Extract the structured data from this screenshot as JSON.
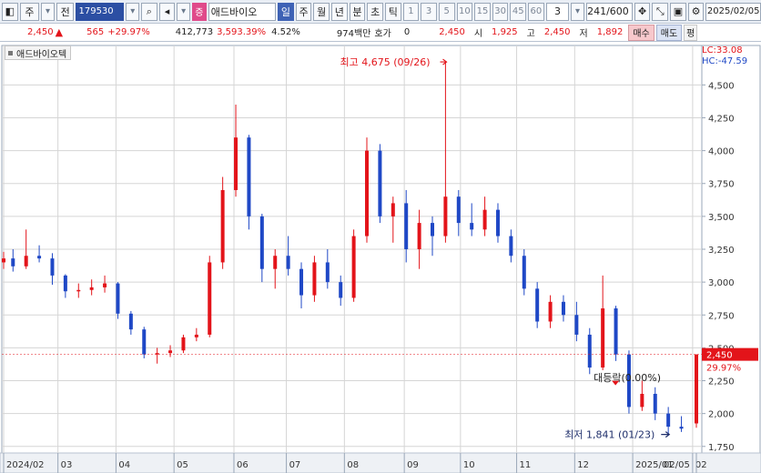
{
  "toolbar": {
    "market": "주",
    "type": "전",
    "code": "179530",
    "badge": "증",
    "name": "애드바이오",
    "periods": [
      "일",
      "주",
      "월",
      "년",
      "분",
      "초",
      "틱"
    ],
    "active_period": "일",
    "intervals": [
      "1",
      "3",
      "5",
      "10",
      "15",
      "30",
      "45",
      "60"
    ],
    "multiplier": "3",
    "count": "241/600",
    "date": "2025/02/05",
    "icons": [
      "chart-type-icon",
      "dropdown-icon",
      "search-icon",
      "speaker-icon",
      "dropdown-icon",
      "crosshair-icon",
      "tools-icon",
      "save-icon",
      "settings-icon"
    ]
  },
  "pricebar": {
    "price": "2,450",
    "arrow": "up",
    "change": "565",
    "change_pct": "+29.97%",
    "volume": "412,773",
    "volume_pct": "3,593.39%",
    "turnover": "4.52%",
    "amount": "974백만",
    "quote_label": "호가",
    "quote_value": "0",
    "quote_price": "2,450",
    "open_label": "시",
    "open": "1,925",
    "high_label": "고",
    "high": "2,450",
    "low_label": "저",
    "low": "1,892",
    "buy": "매수",
    "sell": "매도",
    "avg": "평"
  },
  "chart_header": {
    "stock_name": "애드바이오텍",
    "lc": "LC:33.08",
    "hc": "HC:-47.59"
  },
  "colors": {
    "up": "#e3141a",
    "down": "#1f48c6",
    "grid": "#d5d5d5",
    "background": "#ffffff"
  },
  "chart_data": {
    "type": "candlestick",
    "title": "",
    "xlabel": "",
    "ylabel": "",
    "ylim": [
      1700,
      4800
    ],
    "yticks": [
      1750,
      2000,
      2250,
      2500,
      2750,
      3000,
      3250,
      3500,
      3750,
      4000,
      4250,
      4500
    ],
    "ytick_labels": [
      "1,750",
      "2,000",
      "2,250",
      "2,500",
      "2,750",
      "3,000",
      "3,250",
      "3,500",
      "3,750",
      "4,000",
      "4,250",
      "4,500"
    ],
    "month_ticks": [
      {
        "label": "2024/02",
        "date": "2024-02-01"
      },
      {
        "label": "03",
        "date": "2024-03-01"
      },
      {
        "label": "04",
        "date": "2024-04-01"
      },
      {
        "label": "05",
        "date": "2024-05-02"
      },
      {
        "label": "06",
        "date": "2024-06-03"
      },
      {
        "label": "07",
        "date": "2024-07-01"
      },
      {
        "label": "08",
        "date": "2024-08-01"
      },
      {
        "label": "09",
        "date": "2024-09-02"
      },
      {
        "label": "10",
        "date": "2024-10-02"
      },
      {
        "label": "11",
        "date": "2024-11-01"
      },
      {
        "label": "12",
        "date": "2024-12-02"
      },
      {
        "label": "2025/01",
        "date": "2025-01-02"
      },
      {
        "label": "02",
        "date": "2025-02-03"
      },
      {
        "label": "02/05",
        "date": "2025-02-05"
      }
    ],
    "grid": true,
    "annotations": {
      "high": {
        "label": "최고 4,675 (09/26)",
        "value": 4675,
        "date": "2024-09-26"
      },
      "low": {
        "label": "최저 1,841 (01/23)",
        "value": 1841,
        "date": "2025-01-23"
      },
      "mid": {
        "label": "대등락(0.00%)"
      },
      "current_price": {
        "label": "2,450",
        "value": 2450
      },
      "current_change": {
        "label": "29.97%"
      }
    },
    "series": [
      {
        "date": "2024-02-01",
        "open": 3150,
        "high": 3230,
        "low": 3100,
        "close": 3180
      },
      {
        "date": "2024-02-06",
        "open": 3180,
        "high": 3250,
        "low": 3080,
        "close": 3120
      },
      {
        "date": "2024-02-13",
        "open": 3120,
        "high": 3400,
        "low": 3100,
        "close": 3200
      },
      {
        "date": "2024-02-20",
        "open": 3200,
        "high": 3280,
        "low": 3150,
        "close": 3180
      },
      {
        "date": "2024-02-27",
        "open": 3180,
        "high": 3220,
        "low": 2980,
        "close": 3050
      },
      {
        "date": "2024-03-05",
        "open": 3050,
        "high": 3060,
        "low": 2880,
        "close": 2930
      },
      {
        "date": "2024-03-12",
        "open": 2930,
        "high": 2990,
        "low": 2880,
        "close": 2940
      },
      {
        "date": "2024-03-19",
        "open": 2940,
        "high": 3020,
        "low": 2900,
        "close": 2960
      },
      {
        "date": "2024-03-26",
        "open": 2960,
        "high": 3050,
        "low": 2920,
        "close": 2990
      },
      {
        "date": "2024-04-02",
        "open": 2990,
        "high": 3000,
        "low": 2720,
        "close": 2760
      },
      {
        "date": "2024-04-09",
        "open": 2760,
        "high": 2780,
        "low": 2600,
        "close": 2640
      },
      {
        "date": "2024-04-16",
        "open": 2640,
        "high": 2660,
        "low": 2420,
        "close": 2450
      },
      {
        "date": "2024-04-23",
        "open": 2450,
        "high": 2500,
        "low": 2380,
        "close": 2460
      },
      {
        "date": "2024-04-30",
        "open": 2460,
        "high": 2520,
        "low": 2430,
        "close": 2480
      },
      {
        "date": "2024-05-07",
        "open": 2480,
        "high": 2600,
        "low": 2460,
        "close": 2580
      },
      {
        "date": "2024-05-14",
        "open": 2580,
        "high": 2650,
        "low": 2550,
        "close": 2600
      },
      {
        "date": "2024-05-21",
        "open": 2600,
        "high": 3200,
        "low": 2580,
        "close": 3150
      },
      {
        "date": "2024-05-28",
        "open": 3150,
        "high": 3800,
        "low": 3100,
        "close": 3700
      },
      {
        "date": "2024-06-04",
        "open": 3700,
        "high": 4350,
        "low": 3650,
        "close": 4100
      },
      {
        "date": "2024-06-11",
        "open": 4100,
        "high": 4120,
        "low": 3400,
        "close": 3500
      },
      {
        "date": "2024-06-18",
        "open": 3500,
        "high": 3520,
        "low": 3000,
        "close": 3100
      },
      {
        "date": "2024-06-25",
        "open": 3100,
        "high": 3250,
        "low": 2950,
        "close": 3200
      },
      {
        "date": "2024-07-02",
        "open": 3200,
        "high": 3350,
        "low": 3050,
        "close": 3100
      },
      {
        "date": "2024-07-09",
        "open": 3100,
        "high": 3150,
        "low": 2800,
        "close": 2900
      },
      {
        "date": "2024-07-16",
        "open": 2900,
        "high": 3200,
        "low": 2850,
        "close": 3150
      },
      {
        "date": "2024-07-23",
        "open": 3150,
        "high": 3250,
        "low": 2950,
        "close": 3000
      },
      {
        "date": "2024-07-30",
        "open": 3000,
        "high": 3050,
        "low": 2820,
        "close": 2880
      },
      {
        "date": "2024-08-06",
        "open": 2880,
        "high": 3400,
        "low": 2850,
        "close": 3350
      },
      {
        "date": "2024-08-13",
        "open": 3350,
        "high": 4100,
        "low": 3300,
        "close": 4000
      },
      {
        "date": "2024-08-20",
        "open": 4000,
        "high": 4050,
        "low": 3450,
        "close": 3500
      },
      {
        "date": "2024-08-27",
        "open": 3500,
        "high": 3650,
        "low": 3300,
        "close": 3600
      },
      {
        "date": "2024-09-03",
        "open": 3600,
        "high": 3700,
        "low": 3150,
        "close": 3250
      },
      {
        "date": "2024-09-10",
        "open": 3250,
        "high": 3550,
        "low": 3100,
        "close": 3450
      },
      {
        "date": "2024-09-17",
        "open": 3450,
        "high": 3500,
        "low": 3200,
        "close": 3350
      },
      {
        "date": "2024-09-24",
        "open": 3350,
        "high": 4675,
        "low": 3300,
        "close": 3650
      },
      {
        "date": "2024-10-01",
        "open": 3650,
        "high": 3700,
        "low": 3350,
        "close": 3450
      },
      {
        "date": "2024-10-08",
        "open": 3450,
        "high": 3600,
        "low": 3350,
        "close": 3400
      },
      {
        "date": "2024-10-15",
        "open": 3400,
        "high": 3650,
        "low": 3350,
        "close": 3550
      },
      {
        "date": "2024-10-22",
        "open": 3550,
        "high": 3600,
        "low": 3300,
        "close": 3350
      },
      {
        "date": "2024-10-29",
        "open": 3350,
        "high": 3400,
        "low": 3150,
        "close": 3200
      },
      {
        "date": "2024-11-05",
        "open": 3200,
        "high": 3250,
        "low": 2900,
        "close": 2950
      },
      {
        "date": "2024-11-12",
        "open": 2950,
        "high": 3000,
        "low": 2650,
        "close": 2700
      },
      {
        "date": "2024-11-19",
        "open": 2700,
        "high": 2900,
        "low": 2650,
        "close": 2850
      },
      {
        "date": "2024-11-26",
        "open": 2850,
        "high": 2900,
        "low": 2700,
        "close": 2750
      },
      {
        "date": "2024-12-03",
        "open": 2750,
        "high": 2850,
        "low": 2550,
        "close": 2600
      },
      {
        "date": "2024-12-10",
        "open": 2600,
        "high": 2650,
        "low": 2300,
        "close": 2350
      },
      {
        "date": "2024-12-17",
        "open": 2350,
        "high": 3050,
        "low": 2330,
        "close": 2800
      },
      {
        "date": "2024-12-24",
        "open": 2800,
        "high": 2820,
        "low": 2400,
        "close": 2450
      },
      {
        "date": "2024-12-31",
        "open": 2450,
        "high": 2480,
        "low": 2000,
        "close": 2050
      },
      {
        "date": "2025-01-07",
        "open": 2050,
        "high": 2250,
        "low": 2020,
        "close": 2150
      },
      {
        "date": "2025-01-14",
        "open": 2150,
        "high": 2200,
        "low": 1950,
        "close": 2000
      },
      {
        "date": "2025-01-21",
        "open": 2000,
        "high": 2050,
        "low": 1841,
        "close": 1900
      },
      {
        "date": "2025-01-28",
        "open": 1900,
        "high": 1980,
        "low": 1860,
        "close": 1885
      },
      {
        "date": "2025-02-05",
        "open": 1925,
        "high": 2450,
        "low": 1892,
        "close": 2450
      }
    ]
  }
}
